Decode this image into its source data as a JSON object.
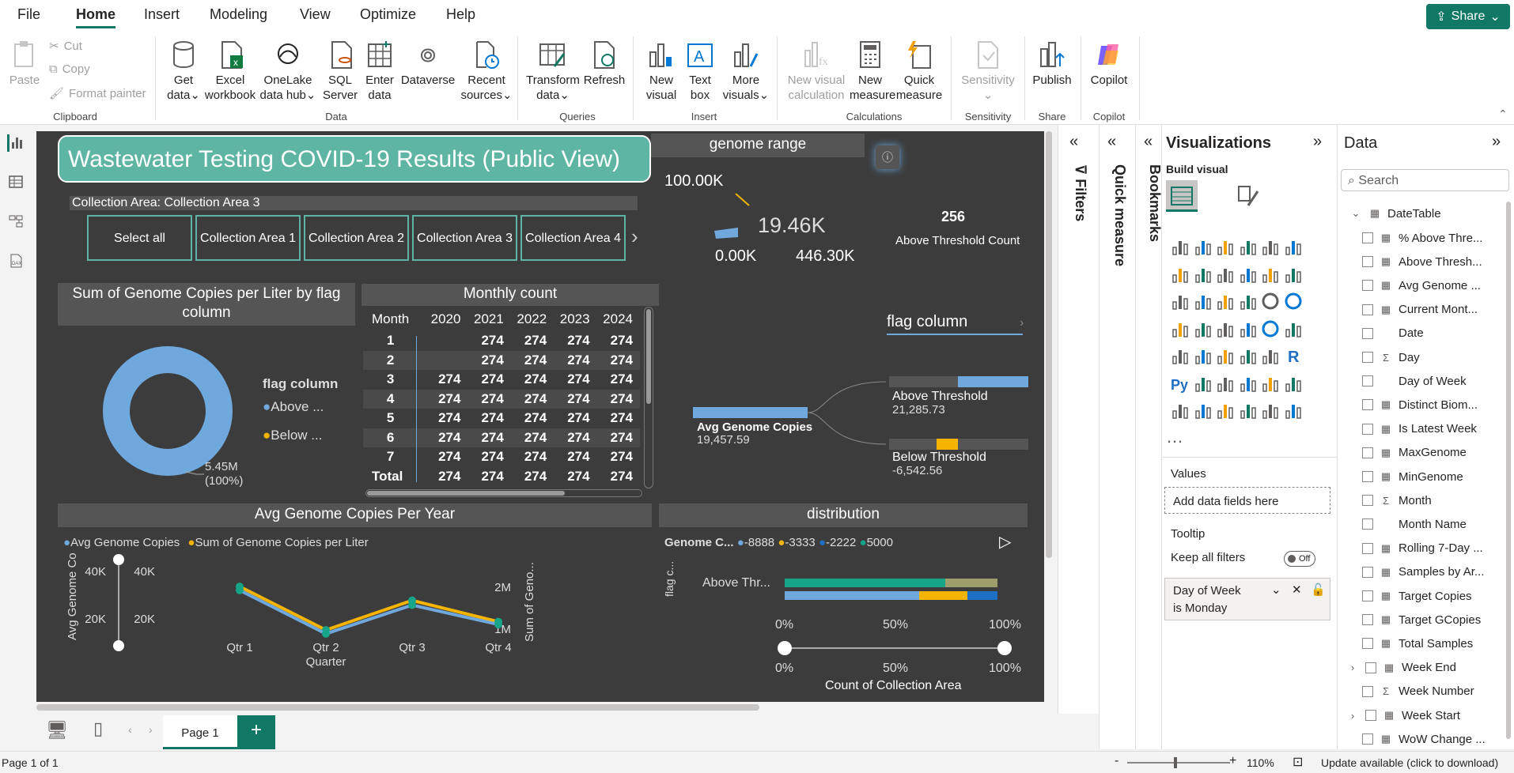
{
  "menu": {
    "file": "File",
    "home": "Home",
    "insert": "Insert",
    "modeling": "Modeling",
    "view": "View",
    "optimize": "Optimize",
    "help": "Help",
    "share": "Share"
  },
  "ribbon": {
    "paste": "Paste",
    "cut": "Cut",
    "copy": "Copy",
    "format_painter": "Format painter",
    "clipboard": "Clipboard",
    "get_data_1": "Get",
    "get_data_2": "data",
    "excel_1": "Excel",
    "excel_2": "workbook",
    "onelake_1": "OneLake",
    "onelake_2": "data hub",
    "sql_1": "SQL",
    "sql_2": "Server",
    "enter_1": "Enter",
    "enter_2": "data",
    "dataverse": "Dataverse",
    "recent_1": "Recent",
    "recent_2": "sources",
    "data_group": "Data",
    "transform_1": "Transform",
    "transform_2": "data",
    "refresh": "Refresh",
    "queries": "Queries",
    "new_visual_1": "New",
    "new_visual_2": "visual",
    "text_box_1": "Text",
    "text_box_2": "box",
    "more_visuals_1": "More",
    "more_visuals_2": "visuals",
    "insert_group": "Insert",
    "nvc_1": "New visual",
    "nvc_2": "calculation",
    "new_measure_1": "New",
    "new_measure_2": "measure",
    "quick_measure_1": "Quick",
    "quick_measure_2": "measure",
    "calculations": "Calculations",
    "sensitivity": "Sensitivity",
    "sensitivity_group": "Sensitivity",
    "publish": "Publish",
    "share_group": "Share",
    "copilot": "Copilot",
    "copilot_group": "Copilot"
  },
  "report": {
    "title": "Wastewater Testing COVID-19 Results (Public View)",
    "genome_range": "genome range",
    "collection_area": "Collection Area: Collection Area 3",
    "slicer": [
      "Select all",
      "Collection Area 1",
      "Collection Area 2",
      "Collection Area 3",
      "Collection Area 4"
    ],
    "gauge": {
      "max": "100.00K",
      "value": "19.46K",
      "min": "0.00K",
      "target": "446.30K",
      "value_num": 19460,
      "min_num": 0,
      "max_num": 446300
    },
    "card": {
      "value": "256",
      "label": "Above Threshold Count"
    },
    "donut": {
      "title": "Sum of Genome Copies per Liter by flag column",
      "legend_title": "flag column",
      "legend": [
        "Above ...",
        "Below ..."
      ],
      "label_value": "5.45M",
      "label_pct": "(100%)"
    },
    "monthly": {
      "title": "Monthly count",
      "headers": [
        "Month",
        "2020",
        "2021",
        "2022",
        "2023",
        "2024"
      ],
      "rows": [
        [
          "1",
          "",
          "274",
          "274",
          "274",
          "274"
        ],
        [
          "2",
          "",
          "274",
          "274",
          "274",
          "274"
        ],
        [
          "3",
          "274",
          "274",
          "274",
          "274",
          "274"
        ],
        [
          "4",
          "274",
          "274",
          "274",
          "274",
          "274"
        ],
        [
          "5",
          "274",
          "274",
          "274",
          "274",
          "274"
        ],
        [
          "6",
          "274",
          "274",
          "274",
          "274",
          "274"
        ],
        [
          "7",
          "274",
          "274",
          "274",
          "274",
          "274"
        ]
      ],
      "total": [
        "Total",
        "274",
        "274",
        "274",
        "274",
        "274"
      ]
    },
    "decomp": {
      "title": "flag column",
      "root_label": "Avg Genome Copies",
      "root_value": "19,457.59",
      "above_label": "Above Threshold",
      "above_value": "21,285.73",
      "below_label": "Below Threshold",
      "below_value": "-6,542.56"
    },
    "line_chart_title": "Avg Genome Copies Per Year",
    "distribution": {
      "title": "distribution",
      "legend_title": "Genome C...",
      "legend": [
        "-8888",
        "-3333",
        "-2222",
        "5000"
      ],
      "y_label": "flag c...",
      "category": "Above Thr...",
      "ticks": [
        "0%",
        "50%",
        "100%"
      ],
      "xlabel": "Count of Collection Area"
    }
  },
  "chart_data": {
    "type": "line",
    "title": "Avg Genome Copies Per Year",
    "categories": [
      "Qtr 1",
      "Qtr 2",
      "Qtr 3",
      "Qtr 4"
    ],
    "xlabel": "Quarter",
    "ylabel": "Avg Genome Co...",
    "y2label": "Sum of Geno...",
    "yticks": [
      "20K",
      "40K"
    ],
    "y2ticks": [
      "1M",
      "2M"
    ],
    "ylim": [
      0,
      50000
    ],
    "series": [
      {
        "name": "Avg Genome Copies",
        "color": "#6fa8dc",
        "values": [
          30000,
          6500,
          22000,
          11500
        ]
      },
      {
        "name": "Sum of Genome Copies per Liter",
        "color": "#f4b400",
        "values": [
          32000,
          8500,
          24500,
          13000
        ]
      }
    ]
  },
  "panes": {
    "filters": "Filters",
    "quick_measure": "Quick measure",
    "bookmarks": "Bookmarks",
    "visualizations": "Visualizations",
    "build_visual": "Build visual",
    "values": "Values",
    "add_fields": "Add data fields here",
    "tooltip": "Tooltip",
    "keep_filters": "Keep all filters",
    "toggle": "Off",
    "filter_card_1": "Day of Week",
    "filter_card_2": "is Monday",
    "data": "Data",
    "search": "Search",
    "table": "DateTable",
    "fields": [
      "% Above Thre...",
      "Above Thresh...",
      "Avg Genome ...",
      "Current Mont...",
      "Date",
      "Day",
      "Day of Week",
      "Distinct Biom...",
      "Is Latest Week",
      "MaxGenome",
      "MinGenome",
      "Month",
      "Month Name",
      "Rolling 7-Day ...",
      "Samples by Ar...",
      "Target Copies",
      "Target GCopies",
      "Total Samples",
      "Week End",
      "Week Number",
      "Week Start",
      "WoW Change ..."
    ]
  },
  "status": {
    "page": "Page 1 of 1",
    "zoom": "110%",
    "update": "Update available (click to download)",
    "tab": "Page 1"
  }
}
